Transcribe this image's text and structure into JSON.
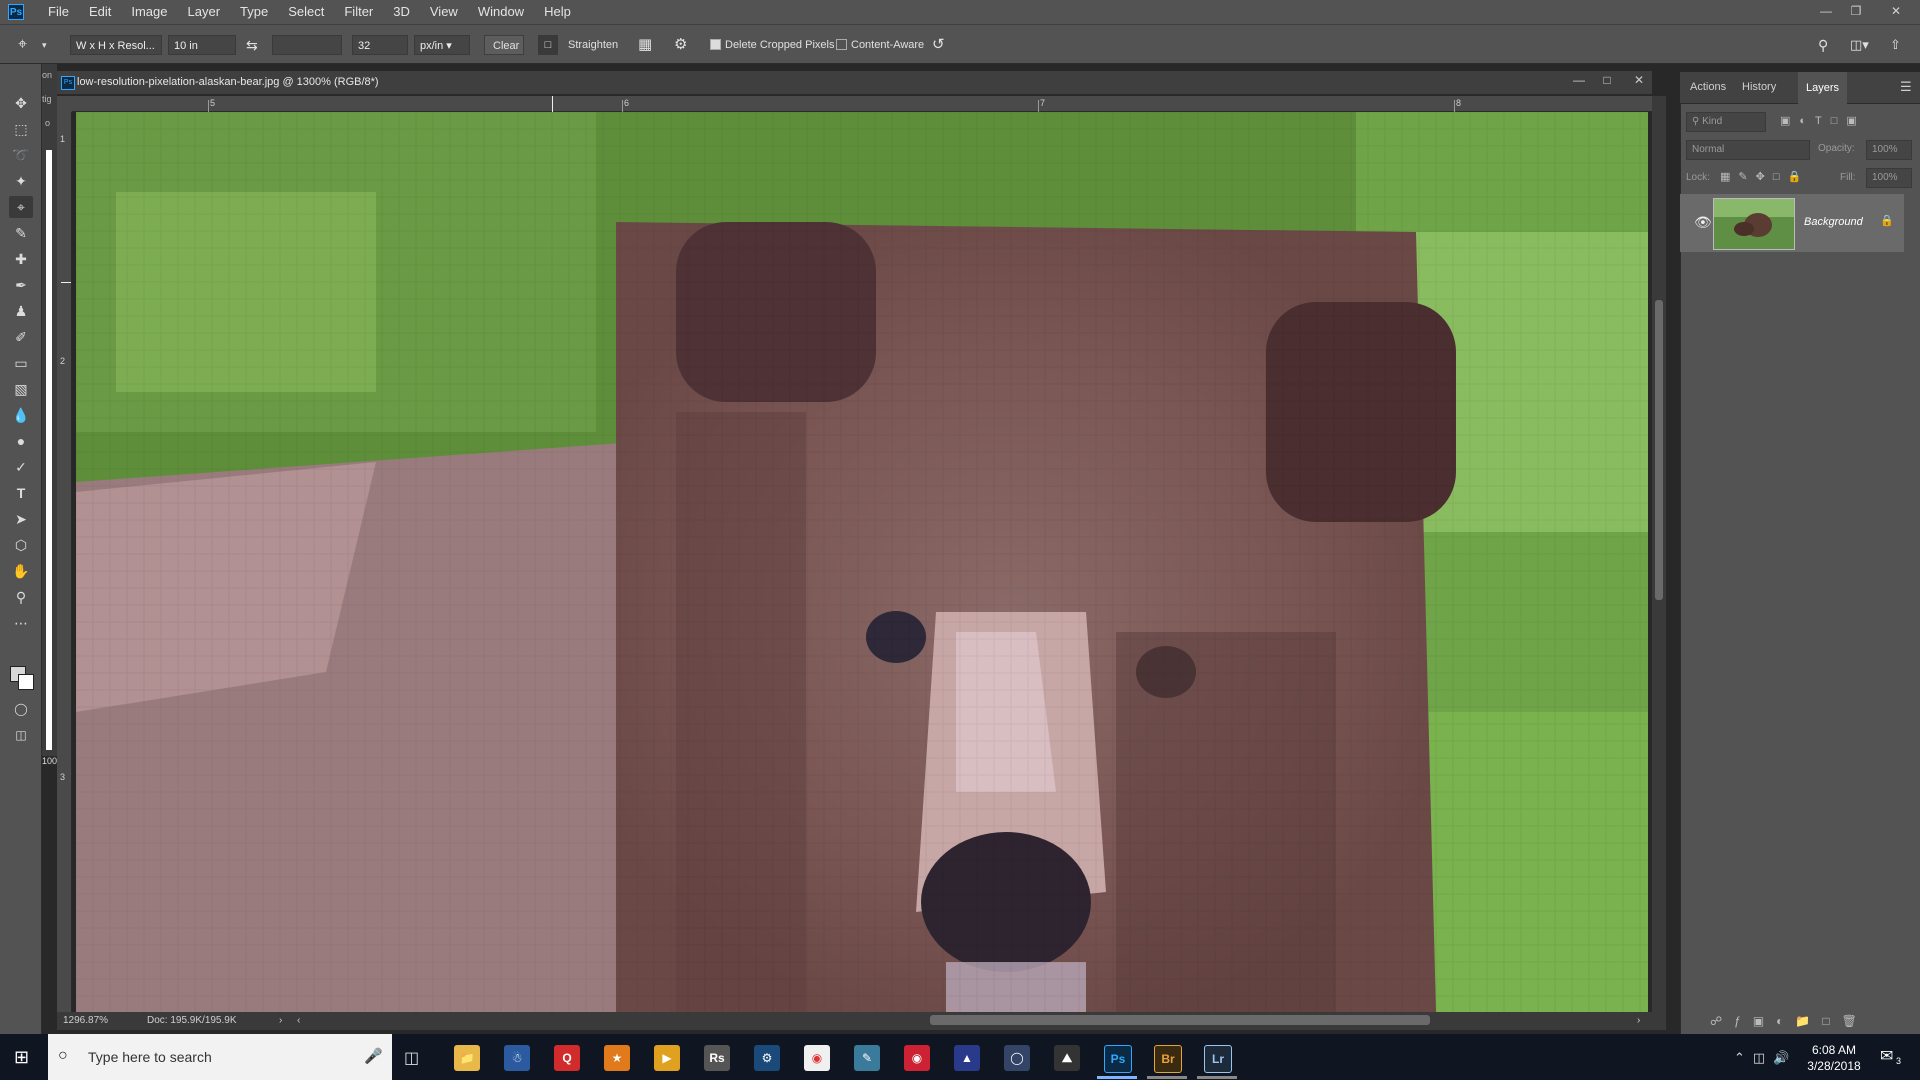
{
  "app": {
    "logo": "Ps"
  },
  "menu": [
    "File",
    "Edit",
    "Image",
    "Layer",
    "Type",
    "Select",
    "Filter",
    "3D",
    "View",
    "Window",
    "Help"
  ],
  "options": {
    "preset": "W x H x Resol...",
    "width": "10 in",
    "height": "",
    "resolution": "32",
    "unit": "px/in",
    "clear": "Clear",
    "straighten": "Straighten",
    "delete_cropped": "Delete Cropped Pixels",
    "delete_cropped_checked": true,
    "content_aware": "Content-Aware",
    "content_aware_checked": false
  },
  "document": {
    "title": "low-resolution-pixelation-alaskan-bear.jpg @ 1300% (RGB/8*)",
    "zoom": "1296.87%",
    "doc_size": "Doc: 195.9K/195.9K",
    "ruler_top": [
      "5",
      "6",
      "7",
      "8"
    ],
    "ruler_left": [
      "1",
      "2",
      "3"
    ],
    "partial_panel_labels": [
      "on",
      "tig",
      "o"
    ],
    "size_hint": "100"
  },
  "panel": {
    "tabs": [
      "Actions",
      "History",
      "Layers"
    ],
    "active_tab": "Layers",
    "kind_placeholder": "Kind",
    "blend_mode": "Normal",
    "opacity_label": "Opacity:",
    "opacity_value": "100%",
    "lock_label": "Lock:",
    "fill_label": "Fill:",
    "fill_value": "100%",
    "layers": [
      {
        "name": "Background",
        "visible": true,
        "locked": true
      }
    ]
  },
  "taskbar": {
    "search_placeholder": "Type here to search",
    "time": "6:08 AM",
    "date": "3/28/2018",
    "notification_count": "3",
    "apps": [
      {
        "label": "Rs",
        "color": "#555555"
      },
      {
        "label": "Ps",
        "color": "#0b2a45"
      },
      {
        "label": "Br",
        "color": "#3a2a10"
      },
      {
        "label": "Lr",
        "color": "#1c2a3a"
      }
    ]
  },
  "colors": {
    "ui_bg": "#535353",
    "ui_dark": "#282828",
    "accent_ps": "#31a8ff",
    "taskbar": "#101522"
  }
}
